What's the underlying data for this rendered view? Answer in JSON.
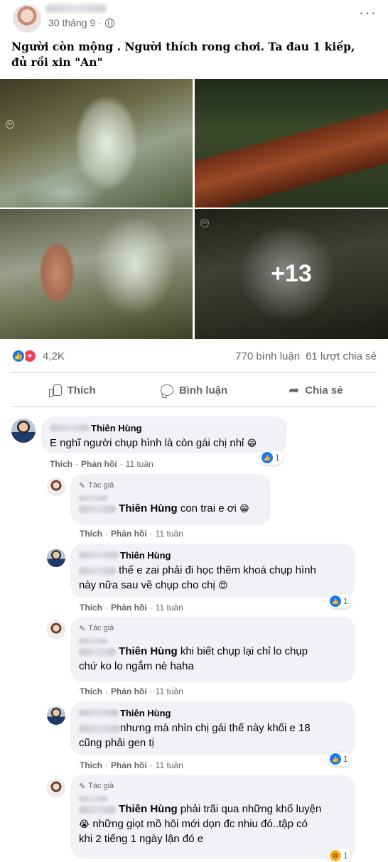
{
  "post": {
    "date": "30 tháng 9 ·",
    "caption": "Người còn mộng . Người thích rong chơi. Ta đau 1 kiếp, đủ rồi xin \"An\"",
    "more_photos": "+13",
    "reaction_count": "4,2K",
    "comment_count": "770 bình luận",
    "share_count": "61 lượt chia sẻ"
  },
  "actions": {
    "like": "Thích",
    "comment": "Bình luận",
    "share": "Chia sẻ"
  },
  "comment_actions": {
    "like": "Thích",
    "reply": "Phản hồi",
    "time": "11 tuần"
  },
  "comments": [
    {
      "name": "Thiên Hùng",
      "text": "E nghĩ người chụp hình là còn gái chị nhỉ",
      "emoji": "😁",
      "reactions": "1"
    },
    {
      "badge": "Tác giả",
      "mention": "Thiên Hùng",
      "text": "con trai e ơi",
      "emoji": "😁"
    },
    {
      "name": "Thiên Hùng",
      "text1": "thế e zai phải đi học thêm khoá chụp hình",
      "text2": "này nữa sau về chụp cho chị",
      "emoji": "😍",
      "reactions": "1"
    },
    {
      "badge": "Tác giả",
      "mention": "Thiên Hùng",
      "text1": "khi biết chụp lại chỉ lo chụp",
      "text2": "chứ ko lo ngắm nè haha"
    },
    {
      "name": "Thiên Hùng",
      "text1": "nhưng mà nhìn chị gái thế này khối e 18",
      "text2": "cũng phải gen tị",
      "reactions": "1"
    },
    {
      "badge": "Tác giả",
      "mention": "Thiên Hùng",
      "text1": "phải trãi qua những khổ luyện",
      "emoji": "😭",
      "text2": "những giọt mồ hôi mới dọn đc nhiu đó..tập có",
      "text3": "khi 2 tiếng 1 ngày lận đó e",
      "reactions": "1"
    }
  ]
}
